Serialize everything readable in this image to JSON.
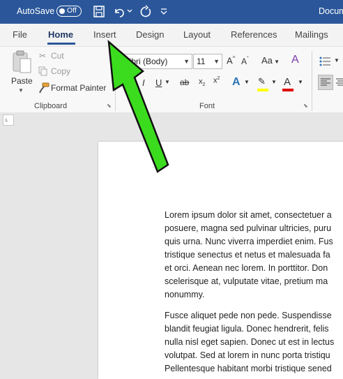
{
  "titlebar": {
    "autosave_label": "AutoSave",
    "autosave_state": "Off",
    "doc_title": "Docum",
    "icons": [
      "save-icon",
      "undo-icon",
      "undo-dropdown-icon",
      "redo-icon",
      "customize-qat-icon"
    ],
    "color": "#2b579a"
  },
  "ribbon": {
    "tabs": [
      "File",
      "Home",
      "Insert",
      "Design",
      "Layout",
      "References",
      "Mailings"
    ],
    "active_tab": "Home",
    "clipboard": {
      "paste_label": "Paste",
      "cut_label": "Cut",
      "copy_label": "Copy",
      "format_painter_label": "Format Painter",
      "group_label": "Clipboard"
    },
    "font": {
      "font_name": "libri (Body)",
      "font_size": "11",
      "group_label": "Font",
      "case_label": "Aa"
    }
  },
  "annotation": {
    "arrow_color": "#3bdc1e",
    "points_to": "Insert"
  },
  "document": {
    "paragraphs": [
      [
        "Lorem ipsum dolor sit amet, consectetuer a",
        "posuere, magna sed pulvinar ultricies, puru",
        "quis urna. Nunc viverra imperdiet enim. Fus",
        "tristique senectus et netus et malesuada fa",
        "et orci. Aenean nec lorem. In porttitor. Don",
        "scelerisque at, vulputate vitae, pretium ma",
        "nonummy."
      ],
      [
        "Fusce aliquet pede non pede. Suspendisse",
        "blandit feugiat ligula. Donec hendrerit, felis",
        "nulla nisl eget sapien. Donec ut est in lectus",
        "volutpat. Sed at lorem in nunc porta tristiqu",
        "Pellentesque habitant morbi tristique sened"
      ]
    ]
  }
}
